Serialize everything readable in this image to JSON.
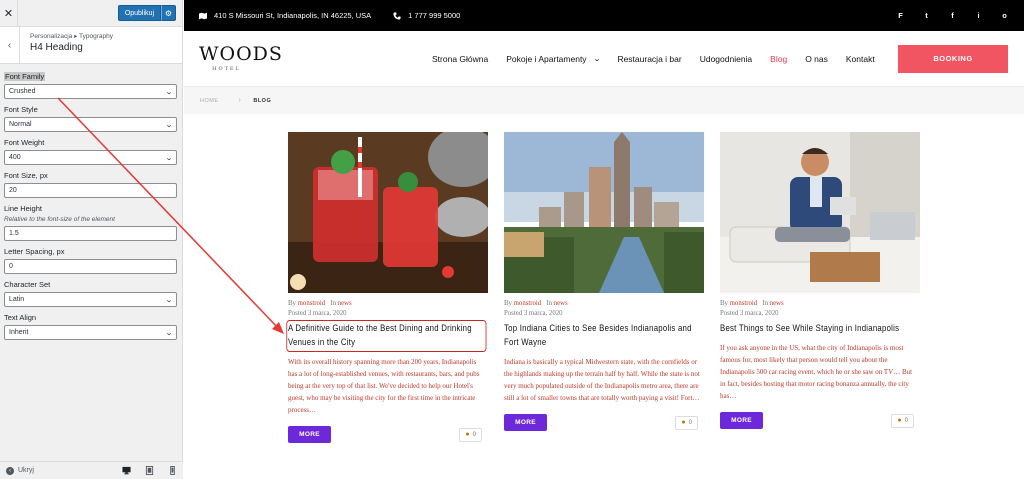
{
  "customizer": {
    "close_icon": "close-icon",
    "publish_label": "Opublikuj",
    "breadcrumb": "Personalizacja ▸ Typography",
    "section_title": "H4 Heading",
    "controls": {
      "font_family": {
        "label": "Font Family",
        "value": "Crushed"
      },
      "font_style": {
        "label": "Font Style",
        "value": "Normal"
      },
      "font_weight": {
        "label": "Font Weight",
        "value": "400"
      },
      "font_size": {
        "label": "Font Size, px",
        "value": "20"
      },
      "line_height": {
        "label": "Line Height",
        "description": "Relative to the font-size of the element",
        "value": "1.5"
      },
      "letter_spacing": {
        "label": "Letter Spacing, px",
        "value": "0"
      },
      "character_set": {
        "label": "Character Set",
        "value": "Latin"
      },
      "text_align": {
        "label": "Text Align",
        "value": "Inherit"
      }
    },
    "hide_label": "Ukryj"
  },
  "site": {
    "topbar": {
      "address": "410 S Missouri St, Indianapolis, IN 46225, USA",
      "phone": "1 777 999 5000",
      "social": [
        "F",
        "t",
        "f",
        "i",
        "o"
      ]
    },
    "logo": {
      "name": "WOODS",
      "sub": "HOTEL"
    },
    "menu": [
      {
        "label": "Strona Główna"
      },
      {
        "label": "Pokoje i Apartamenty"
      },
      {
        "label": "Restauracja i bar"
      },
      {
        "label": "Udogodnienia"
      },
      {
        "label": "Blog"
      },
      {
        "label": "O nas"
      },
      {
        "label": "Kontakt"
      }
    ],
    "booking_label": "BOOKING",
    "breadcrumb": {
      "home": "HOME",
      "sep": "›",
      "current": "BLOG"
    },
    "posts": [
      {
        "by": "By",
        "author": "monstroid",
        "in": "In",
        "category": "news",
        "date": "Posted 3 marca, 2020",
        "title": "A Definitive Guide to the Best Dining and Drinking Venues in the City",
        "excerpt": "With its overall history spanning more than 200 years, Indianapolis has a lot of long-established venues, with restaurants, bars, and pubs being at the very top of that list. We've decided to help our Hotel's guest, who may be visiting the city for the first time in the intricate process…",
        "more": "MORE",
        "comments": "0"
      },
      {
        "by": "By",
        "author": "monstroid",
        "in": "In",
        "category": "news",
        "date": "Posted 3 marca, 2020",
        "title": "Top Indiana Cities to See Besides Indianapolis and Fort Wayne",
        "excerpt": "Indiana is basically a typical Midwestern state, with the cornfields or the highlands making up the terrain half by half. While the state is not very much populated outside of the Indianapolis metro area, there are still a lot of smaller towns that are totally worth paying a visit! Fort…",
        "more": "MORE",
        "comments": "0"
      },
      {
        "by": "By",
        "author": "monstroid",
        "in": "In",
        "category": "news",
        "date": "Posted 3 marca, 2020",
        "title": "Best Things to See While Staying in Indianapolis",
        "excerpt": "If you ask anyone in the US, what the city of Indianapolis is most famous for, most likely that person would tell you about the Indianapolis 500 car racing event, which he or she saw on TV… But in fact, besides hosting that motor racing bonanza annually, the city has…",
        "more": "MORE",
        "comments": "0"
      }
    ]
  },
  "colors": {
    "accent": "#e83d4f",
    "publish": "#2271b1",
    "more": "#6d28d9",
    "annotation": "#e53935"
  }
}
